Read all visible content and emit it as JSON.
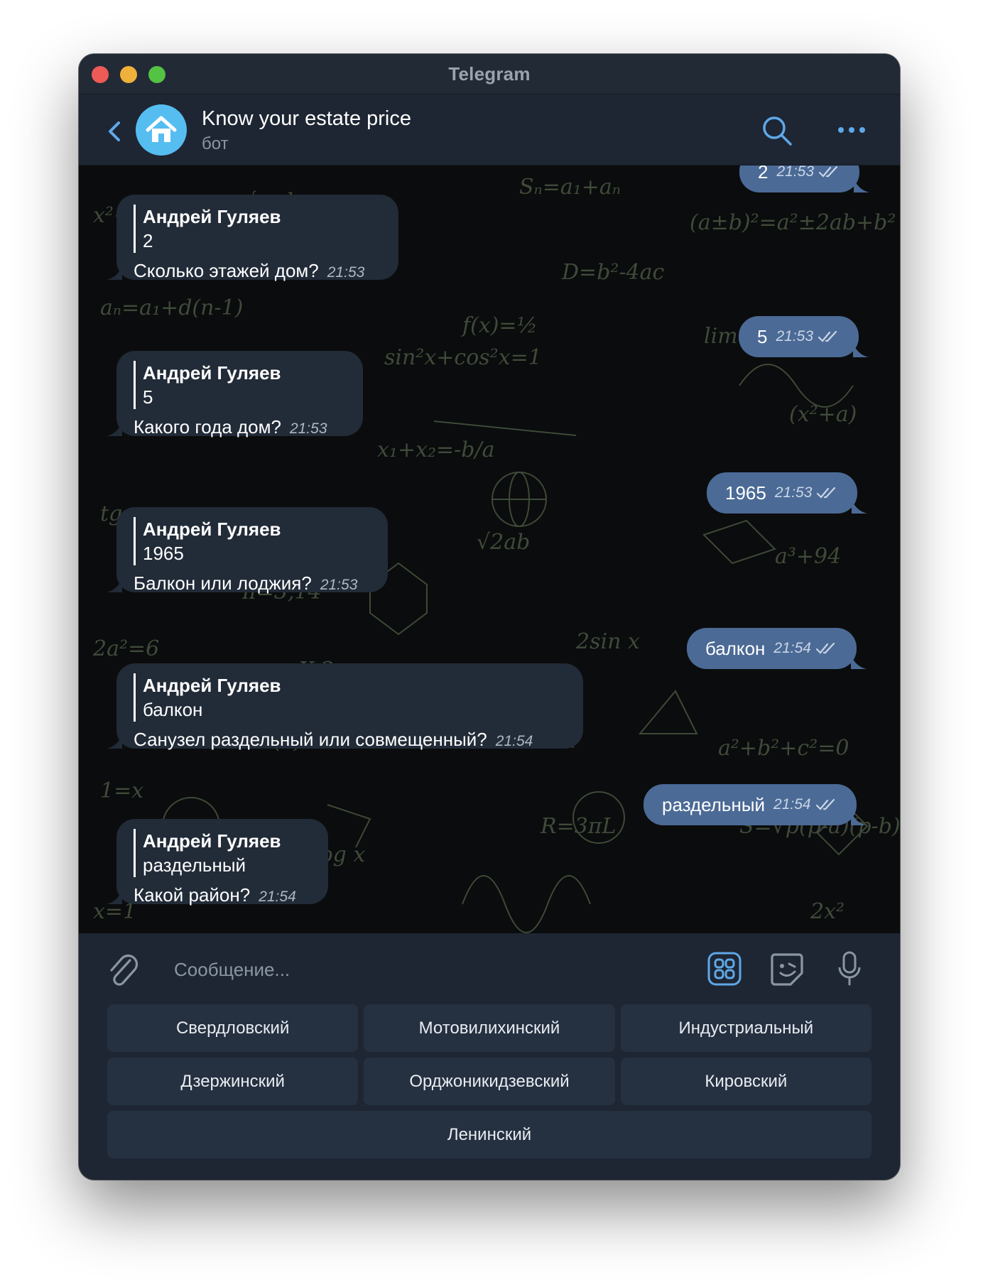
{
  "window": {
    "title": "Telegram"
  },
  "header": {
    "chat_title": "Know your estate price",
    "chat_subtitle": "бот"
  },
  "messages": {
    "top_partial_out": {
      "text": "2",
      "time": "21:53"
    },
    "in_1": {
      "quote_name": "Андрей Гуляев",
      "quote_text": "2",
      "text": "Сколько этажей дом?",
      "time": "21:53"
    },
    "out_1": {
      "text": "5",
      "time": "21:53"
    },
    "in_2": {
      "quote_name": "Андрей Гуляев",
      "quote_text": "5",
      "text": "Какого года дом?",
      "time": "21:53"
    },
    "out_2": {
      "text": "1965",
      "time": "21:53"
    },
    "in_3": {
      "quote_name": "Андрей Гуляев",
      "quote_text": "1965",
      "text": "Балкон или лоджия?",
      "time": "21:53"
    },
    "out_3": {
      "text": "балкон",
      "time": "21:54"
    },
    "in_4": {
      "quote_name": "Андрей Гуляев",
      "quote_text": "балкон",
      "text": "Санузел раздельный или совмещенный?",
      "time": "21:54"
    },
    "out_4": {
      "text": "раздельный",
      "time": "21:54"
    },
    "in_5": {
      "quote_name": "Андрей Гуляев",
      "quote_text": "раздельный",
      "text": "Какой район?",
      "time": "21:54"
    }
  },
  "composer": {
    "placeholder": "Сообщение..."
  },
  "bot_keyboard": {
    "row1": [
      "Свердловский",
      "Мотовилихинский",
      "Индустриальный"
    ],
    "row2": [
      "Дзержинский",
      "Орджоникидзевский",
      "Кировский"
    ],
    "row3": [
      "Ленинский"
    ]
  },
  "colors": {
    "accent": "#5fa8e8",
    "incoming_bubble": "#222b38",
    "outgoing_bubble": "#4b6a96",
    "panel": "#1e2633"
  },
  "icons": {
    "back": "chevron-left-icon",
    "avatar": "house-icon",
    "search": "search-icon",
    "more": "more-dots-icon",
    "attach": "paperclip-icon",
    "bot_keyboard": "keyboard-grid-icon",
    "sticker": "sticker-icon",
    "mic": "microphone-icon"
  }
}
